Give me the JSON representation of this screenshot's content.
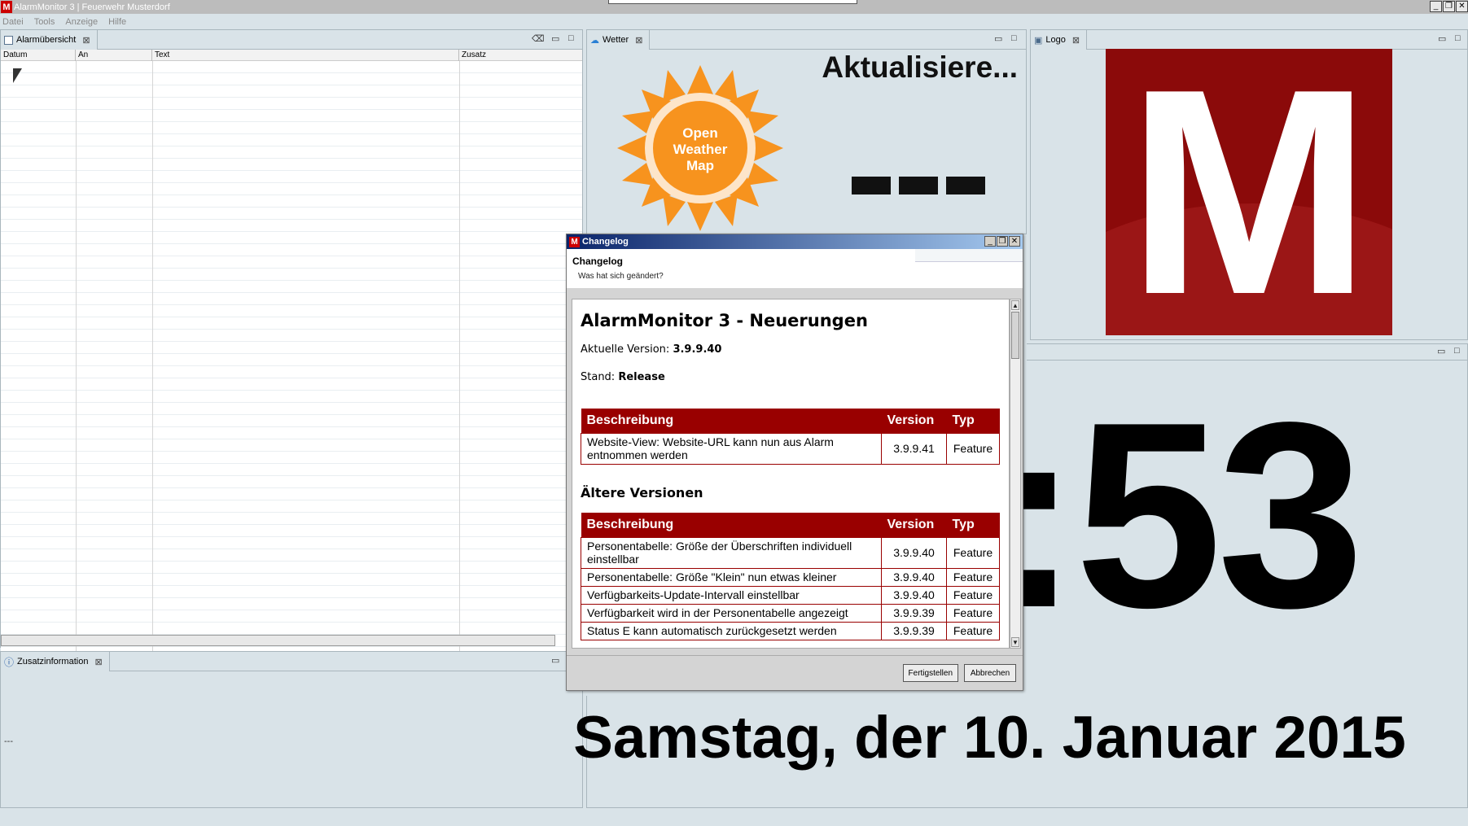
{
  "window": {
    "title": "AlarmMonitor 3 | Feuerwehr Musterdorf",
    "app_icon": "M",
    "controls": [
      "_",
      "❐",
      "✕"
    ]
  },
  "menu": [
    "Datei",
    "Tools",
    "Anzeige",
    "Hilfe"
  ],
  "alarm_panel": {
    "tab_label": "Alarmübersicht",
    "columns": [
      "Datum",
      "An",
      "Text",
      "Zusatz"
    ]
  },
  "zusatz_panel": {
    "tab_label": "Zusatzinformation",
    "content": "---"
  },
  "weather_panel": {
    "tab_label": "Wetter",
    "status": "Aktualisiere...",
    "logo_lines": [
      "Open",
      "Weather",
      "Map"
    ],
    "sun_color": "#f7931e"
  },
  "logo_panel": {
    "tab_label": "Logo",
    "letter": "M",
    "bg_color": "#8b0a0a"
  },
  "clock": {
    "digits": ":53",
    "date": "Samstag, der 10. Januar 2015"
  },
  "dialog": {
    "title": "Changelog",
    "header_title": "Changelog",
    "header_subtitle": "Was hat sich geändert?",
    "heading": "AlarmMonitor 3 - Neuerungen",
    "version_label": "Aktuelle Version:",
    "version_value": "3.9.9.40",
    "stand_label": "Stand:",
    "stand_value": "Release",
    "columns": [
      "Beschreibung",
      "Version",
      "Typ"
    ],
    "current": [
      {
        "desc": "Website-View: Website-URL kann nun aus Alarm entnommen werden",
        "version": "3.9.9.41",
        "type": "Feature"
      }
    ],
    "older_title": "Ältere Versionen",
    "older": [
      {
        "desc": "Personentabelle: Größe der Überschriften individuell einstellbar",
        "version": "3.9.9.40",
        "type": "Feature"
      },
      {
        "desc": "Personentabelle: Größe \"Klein\" nun etwas kleiner",
        "version": "3.9.9.40",
        "type": "Feature"
      },
      {
        "desc": "Verfügbarkeits-Update-Intervall einstellbar",
        "version": "3.9.9.40",
        "type": "Feature"
      },
      {
        "desc": "Verfügbarkeit wird in der Personentabelle angezeigt",
        "version": "3.9.9.39",
        "type": "Feature"
      },
      {
        "desc": "Status E kann automatisch zurückgesetzt werden",
        "version": "3.9.9.39",
        "type": "Feature"
      }
    ],
    "finish_label": "Fertigstellen",
    "cancel_label": "Abbrechen",
    "accent_color": "#990000"
  }
}
